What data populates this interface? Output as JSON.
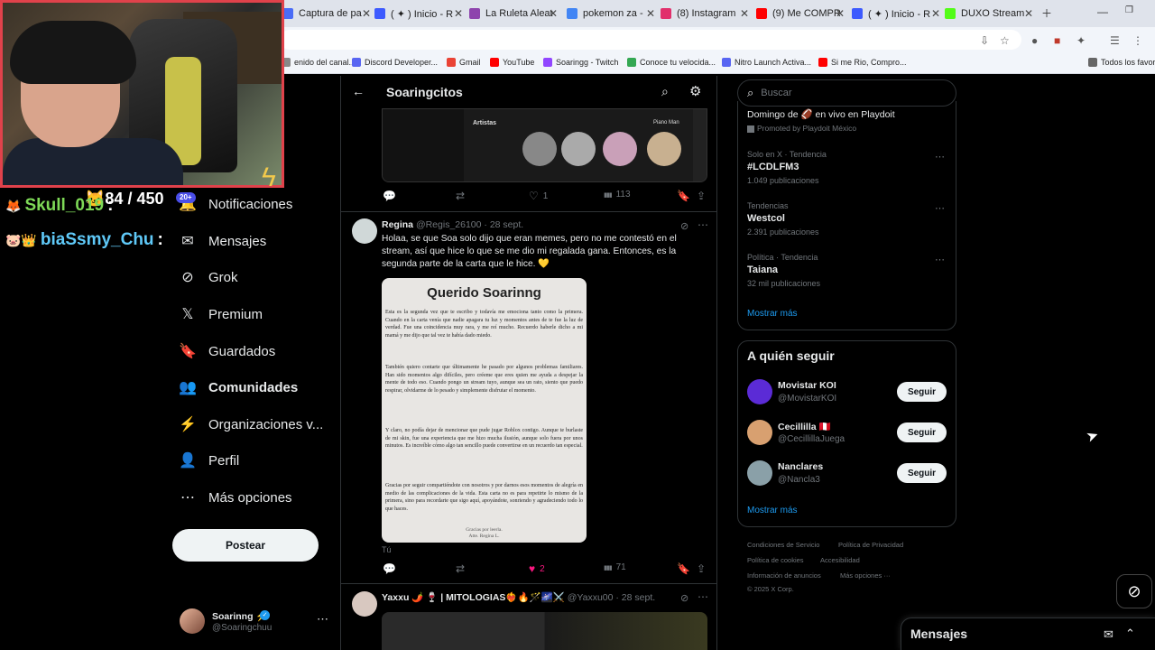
{
  "browser": {
    "tabs": [
      {
        "label": "Captura de pa",
        "color": "#4a6cf7"
      },
      {
        "label": "( ✦ ) Inicio - R",
        "color": "#3d5afe"
      },
      {
        "label": "La Ruleta Aleat",
        "color": "#8e44ad"
      },
      {
        "label": "pokemon za -",
        "color": "#4285f4"
      },
      {
        "label": "(8) Instagram",
        "color": "#e1306c"
      },
      {
        "label": "(9) Me COMPR",
        "color": "#ff0000"
      },
      {
        "label": "( ✦ ) Inicio - R",
        "color": "#3d5afe"
      },
      {
        "label": "DUXO Stream",
        "color": "#53fc18"
      }
    ],
    "bookmarks": [
      {
        "label": "enido del canal...",
        "color": "#888"
      },
      {
        "label": "Discord Developer...",
        "color": "#5865f2"
      },
      {
        "label": "Gmail",
        "color": "#ea4335"
      },
      {
        "label": "YouTube",
        "color": "#ff0000"
      },
      {
        "label": "Soaringg - Twitch",
        "color": "#9146ff"
      },
      {
        "label": "Conoce tu velocida...",
        "color": "#34a853"
      },
      {
        "label": "Nitro Launch Activa...",
        "color": "#5865f2"
      },
      {
        "label": "Si me Rio, Compro...",
        "color": "#ff0000"
      },
      {
        "label": "Todos los favori",
        "color": "#666"
      }
    ]
  },
  "stream": {
    "counter": "84 / 450",
    "badge": "20+",
    "chat": [
      {
        "user": "Skull_019",
        "suffix": ":",
        "color": "#7ed957"
      },
      {
        "user": "biaSsmy_Chu",
        "suffix": ":",
        "color": "#5fc9f8"
      }
    ]
  },
  "nav": {
    "items": [
      {
        "label": "Notificaciones",
        "icon": "bell-icon",
        "glyph": "🔔"
      },
      {
        "label": "Mensajes",
        "icon": "mail-icon",
        "glyph": "✉"
      },
      {
        "label": "Grok",
        "icon": "grok-icon",
        "glyph": "⊘"
      },
      {
        "label": "Premium",
        "icon": "x-logo-icon",
        "glyph": "𝕏"
      },
      {
        "label": "Guardados",
        "icon": "bookmark-icon",
        "glyph": "🔖"
      },
      {
        "label": "Comunidades",
        "icon": "people-icon",
        "glyph": "👥"
      },
      {
        "label": "Organizaciones v...",
        "icon": "lightning-icon",
        "glyph": "⚡"
      },
      {
        "label": "Perfil",
        "icon": "person-icon",
        "glyph": "👤"
      },
      {
        "label": "Más opciones",
        "icon": "more-circle-icon",
        "glyph": "⋯"
      }
    ],
    "post_label": "Postear",
    "profile": {
      "name": "Soarinng ⚡",
      "handle": "@Soaringchuu"
    }
  },
  "feed": {
    "title": "Soaringcitos",
    "media_labels": {
      "artists": "Artistas",
      "piano": "Piano Man"
    },
    "post1_actions": {
      "likes": "1",
      "views": "113"
    },
    "post2": {
      "name": "Regina",
      "handle": "@Regis_26100",
      "date": "· 28 sept.",
      "text": "Holaa, se que Soa solo dijo que eran memes, pero no me contestó en el stream, así que hice lo que se me dio mi regalada gana. Entonces, es la segunda parte de la carta que le hice. 💛",
      "letter_title": "Querido Soarinng",
      "letter_paragraphs": [
        "Esta es la segunda vez que te escribo y todavía me emociona tanto como la primera. Cuando en la carta venía que nadie apagara tu luz y momentos antes de te fue la luz de verdad. Fue una coincidencia muy rara, y me reí mucho. Recuerdo haberle dicho a mi mamá y me dijo que tal vez te había dado miedo.",
        "También quiero contarte que últimamente he pasado por algunos problemas familiares. Han sido momentos algo difíciles, pero créeme que eres quien me ayuda a despejar la mente de todo eso. Cuando pongo un stream tuyo, aunque sea un rato, siento que puedo respirar, olvidarme de lo pesado y simplemente disfrutar el momento.",
        "Y claro, no podía dejar de mencionar que pude jugar Roblox contigo. Aunque te burlaste de mi skin, fue una experiencia que me hizo mucha ilusión, aunque solo fuera por unos minutos. Es increíble cómo algo tan sencillo puede convertirse en un recuerdo tan especial.",
        "Gracias por seguir compartiéndote con nosotros y por darnos esos momentos de alegría en medio de las complicaciones de la vida. Esta carta no es para repetirte lo mismo de la primera, sino para recordarte que sigo aquí, apoyándote, sonriendo y agradeciendo todo lo que haces."
      ],
      "letter_sign": "Gracias por leerla.",
      "letter_sign2": "Atte. Regina L.",
      "reply_label": "Tú",
      "likes": "2",
      "views": "71"
    },
    "post3": {
      "name": "Yaxxu 🌶️ 🍷 | MITOLOGIAS❤️‍🔥🔥🪄🌌⚔️",
      "handle": "@Yaxxu00",
      "date": "· 28 sept."
    }
  },
  "sidebar": {
    "search_placeholder": "Buscar",
    "promo": {
      "title": "Domingo de 🏈 en vivo en Playdoit",
      "promoted": "Promoted by Playdoit México"
    },
    "trends": [
      {
        "meta": "Solo en X · Tendencia",
        "name": "#LCDLFM3",
        "count": "1.049 publicaciones"
      },
      {
        "meta": "Tendencias",
        "name": "Westcol",
        "count": "2.391 publicaciones"
      },
      {
        "meta": "Política · Tendencia",
        "name": "Taiana",
        "count": "32 mil publicaciones"
      }
    ],
    "show_more": "Mostrar más",
    "who_to_follow_title": "A quién seguir",
    "follow": [
      {
        "name": "Movistar KOI",
        "handle": "@MovistarKOI",
        "color": "#5b2bd6"
      },
      {
        "name": "Cecillilla 🇵🇪",
        "handle": "@CecillillaJuega",
        "color": "#d8a070"
      },
      {
        "name": "Nanclares",
        "handle": "@Nancla3",
        "color": "#8aa0a8"
      }
    ],
    "follow_label": "Seguir",
    "footer": [
      "Condiciones de Servicio",
      "Política de Privacidad",
      "Política de cookies",
      "Accesibilidad",
      "Información de anuncios",
      "Más opciones ···",
      "© 2025 X Corp."
    ]
  },
  "messages": {
    "title": "Mensajes"
  }
}
